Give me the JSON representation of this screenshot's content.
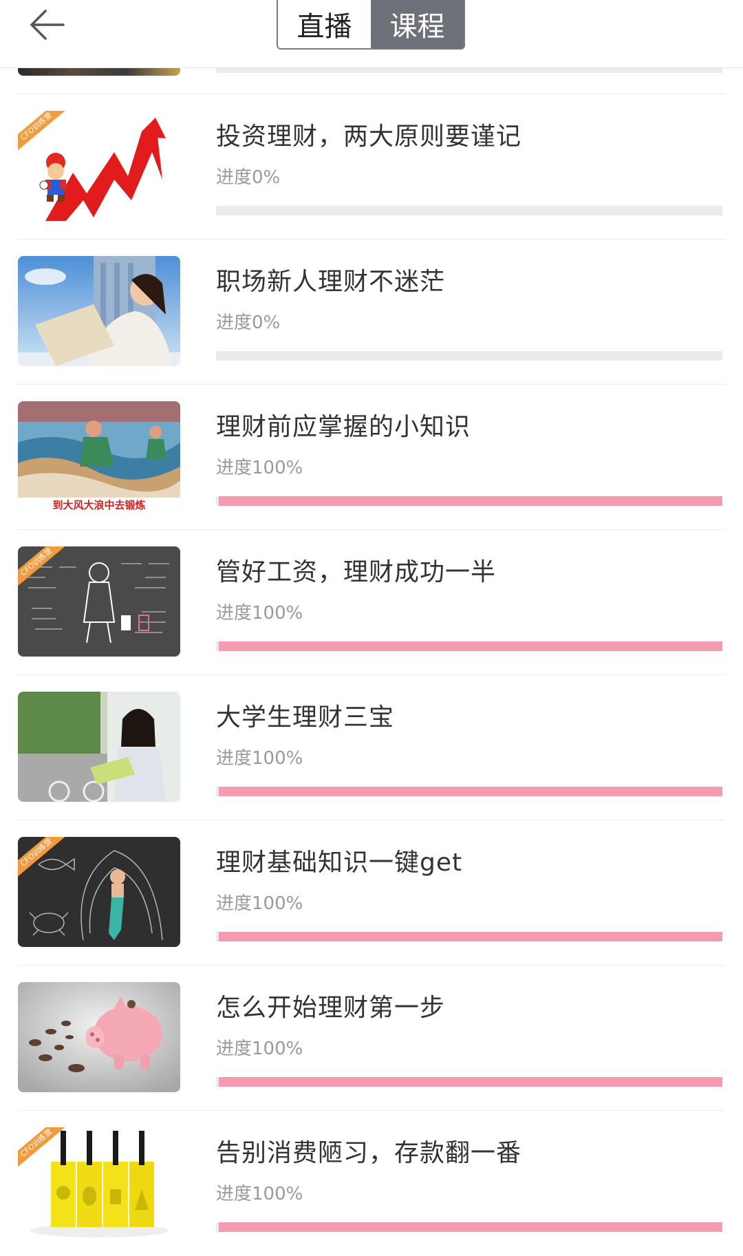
{
  "header": {
    "back_label": "back",
    "tabs": [
      {
        "label": "直播",
        "active": false
      },
      {
        "label": "课程",
        "active": true
      }
    ]
  },
  "colors": {
    "progress_fill": "#f49bb0",
    "progress_track": "#ebebeb",
    "tab_active_bg": "#6e7178",
    "badge": "#f39a3a"
  },
  "courses": [
    {
      "title": "投资理财，两大原则要谨记",
      "progress_label": "进度0%",
      "progress": 0,
      "badge": "CFO训练营",
      "image": "mario-arrow-chart"
    },
    {
      "title": "职场新人理财不迷茫",
      "progress_label": "进度0%",
      "progress": 0,
      "badge": "",
      "image": "woman-reading-city"
    },
    {
      "title": "理财前应掌握的小知识",
      "progress_label": "进度100%",
      "progress": 100,
      "badge": "",
      "image": "poster-waves",
      "caption": "到大风大浪中去锻炼"
    },
    {
      "title": "管好工资，理财成功一半",
      "progress_label": "进度100%",
      "progress": 100,
      "badge": "CFO训练营",
      "image": "chalkboard-girl"
    },
    {
      "title": "大学生理财三宝",
      "progress_label": "进度100%",
      "progress": 100,
      "badge": "",
      "image": "student-reading"
    },
    {
      "title": "理财基础知识一键get",
      "progress_label": "进度100%",
      "progress": 100,
      "badge": "CFO训练营",
      "image": "chalk-baby"
    },
    {
      "title": "怎么开始理财第一步",
      "progress_label": "进度100%",
      "progress": 100,
      "badge": "",
      "image": "piggy-bank-coins"
    },
    {
      "title": "告别消费陋习，存款翻一番",
      "progress_label": "进度100%",
      "progress": 100,
      "badge": "CFO训练营",
      "image": "yellow-tags"
    }
  ]
}
